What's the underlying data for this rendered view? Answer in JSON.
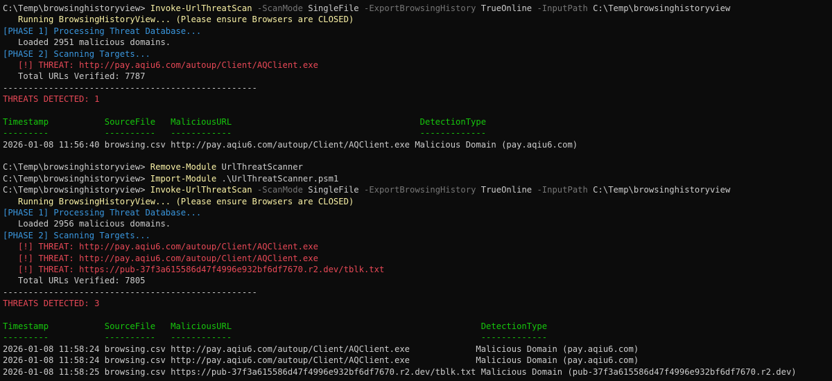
{
  "lines": [
    [
      {
        "t": "C:\\Temp\\browsinghistoryview> ",
        "c": "w"
      },
      {
        "t": "Invoke-UrlThreatScan",
        "c": "y"
      },
      {
        "t": " -ScanMode",
        "c": "g"
      },
      {
        "t": " SingleFile",
        "c": "w"
      },
      {
        "t": " -ExportBrowsingHistory",
        "c": "g"
      },
      {
        "t": " TrueOnline",
        "c": "w"
      },
      {
        "t": " -InputPath",
        "c": "g"
      },
      {
        "t": " C:\\Temp\\browsinghistoryview",
        "c": "w"
      }
    ],
    [
      {
        "t": "   Running BrowsingHistoryView... (Please ensure Browsers are CLOSED)",
        "c": "y"
      }
    ],
    [
      {
        "t": "[PHASE 1] Processing Threat Database...",
        "c": "c"
      }
    ],
    [
      {
        "t": "   Loaded 2951 malicious domains.",
        "c": "w"
      }
    ],
    [
      {
        "t": "[PHASE 2] Scanning Targets...",
        "c": "c"
      }
    ],
    [
      {
        "t": "   [!] THREAT: http://pay.aqiu6.com/autoup/Client/AQClient.exe",
        "c": "r"
      }
    ],
    [
      {
        "t": "   Total URLs Verified: 7787",
        "c": "w"
      }
    ],
    [
      {
        "t": "--------------------------------------------------",
        "c": "w"
      }
    ],
    [
      {
        "t": "THREATS DETECTED: 1",
        "c": "r"
      }
    ],
    [],
    [
      {
        "t": "Timestamp           SourceFile   MaliciousURL                                     DetectionType",
        "c": "gr"
      }
    ],
    [
      {
        "t": "---------           ----------   ------------                                     -------------",
        "c": "gr"
      }
    ],
    [
      {
        "t": "2026-01-08 11:56:40 browsing.csv http://pay.aqiu6.com/autoup/Client/AQClient.exe Malicious Domain (pay.aqiu6.com)",
        "c": "w"
      }
    ],
    [],
    [
      {
        "t": "C:\\Temp\\browsinghistoryview> ",
        "c": "w"
      },
      {
        "t": "Remove-Module",
        "c": "y"
      },
      {
        "t": " UrlThreatScanner",
        "c": "w"
      }
    ],
    [
      {
        "t": "C:\\Temp\\browsinghistoryview> ",
        "c": "w"
      },
      {
        "t": "Import-Module",
        "c": "y"
      },
      {
        "t": " .\\UrlThreatScanner.psm1",
        "c": "w"
      }
    ],
    [
      {
        "t": "C:\\Temp\\browsinghistoryview> ",
        "c": "w"
      },
      {
        "t": "Invoke-UrlThreatScan",
        "c": "y"
      },
      {
        "t": " -ScanMode",
        "c": "g"
      },
      {
        "t": " SingleFile",
        "c": "w"
      },
      {
        "t": " -ExportBrowsingHistory",
        "c": "g"
      },
      {
        "t": " TrueOnline",
        "c": "w"
      },
      {
        "t": " -InputPath",
        "c": "g"
      },
      {
        "t": " C:\\Temp\\browsinghistoryview",
        "c": "w"
      }
    ],
    [
      {
        "t": "   Running BrowsingHistoryView... (Please ensure Browsers are CLOSED)",
        "c": "y"
      }
    ],
    [
      {
        "t": "[PHASE 1] Processing Threat Database...",
        "c": "c"
      }
    ],
    [
      {
        "t": "   Loaded 2956 malicious domains.",
        "c": "w"
      }
    ],
    [
      {
        "t": "[PHASE 2] Scanning Targets...",
        "c": "c"
      }
    ],
    [
      {
        "t": "   [!] THREAT: http://pay.aqiu6.com/autoup/Client/AQClient.exe",
        "c": "r"
      }
    ],
    [
      {
        "t": "   [!] THREAT: http://pay.aqiu6.com/autoup/Client/AQClient.exe",
        "c": "r"
      }
    ],
    [
      {
        "t": "   [!] THREAT: https://pub-37f3a615586d47f4996e932bf6df7670.r2.dev/tblk.txt",
        "c": "r"
      }
    ],
    [
      {
        "t": "   Total URLs Verified: 7805",
        "c": "w"
      }
    ],
    [
      {
        "t": "--------------------------------------------------",
        "c": "w"
      }
    ],
    [
      {
        "t": "THREATS DETECTED: 3",
        "c": "r"
      }
    ],
    [],
    [
      {
        "t": "Timestamp           SourceFile   MaliciousURL                                                 DetectionType",
        "c": "gr"
      }
    ],
    [
      {
        "t": "---------           ----------   ------------                                                 -------------",
        "c": "gr"
      }
    ],
    [
      {
        "t": "2026-01-08 11:58:24 browsing.csv http://pay.aqiu6.com/autoup/Client/AQClient.exe             Malicious Domain (pay.aqiu6.com)",
        "c": "w"
      }
    ],
    [
      {
        "t": "2026-01-08 11:58:24 browsing.csv http://pay.aqiu6.com/autoup/Client/AQClient.exe             Malicious Domain (pay.aqiu6.com)",
        "c": "w"
      }
    ],
    [
      {
        "t": "2026-01-08 11:58:25 browsing.csv https://pub-37f3a615586d47f4996e932bf6df7670.r2.dev/tblk.txt Malicious Domain (pub-37f3a615586d47f4996e932bf6df7670.r2.dev)",
        "c": "w"
      }
    ]
  ]
}
